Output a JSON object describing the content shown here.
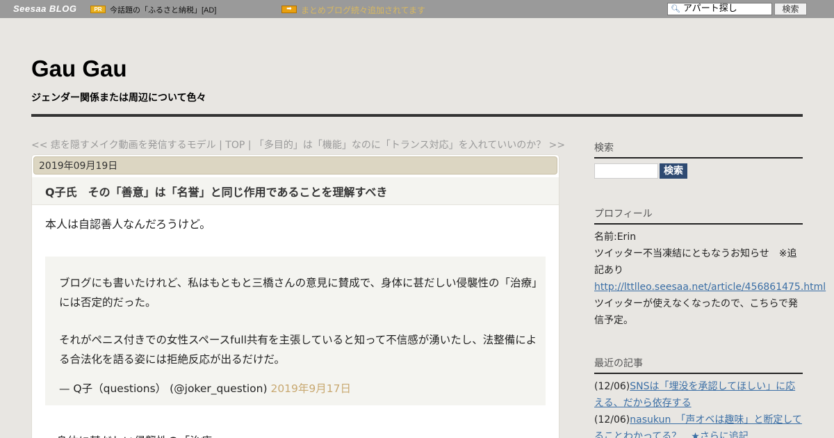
{
  "topbar": {
    "logo": "Seesaa BLOG",
    "pr_badge": "PR",
    "ad_text": "今話題の「ふるさと納税」[AD]",
    "arrow_badge": "➡",
    "notice": "まとめブログ続々追加されてます",
    "search_value": "アパート探し",
    "search_button": "検索"
  },
  "header": {
    "title": "Gau Gau",
    "description": "ジェンダー関係または周辺について色々"
  },
  "post_nav": {
    "prev": "<< 痣を隠すメイク動画を発信するモデル",
    "sep1": " | ",
    "top": "TOP",
    "sep2": " | ",
    "next": "「多目的」は「機能」なのに「トランス対応」を入れていいのか？ >>"
  },
  "article": {
    "date": "2019年09月19日",
    "title": "Q子氏　その「善意」は「名誉」と同じ作用であることを理解すべき",
    "intro": "本人は自認善人なんだろうけど。",
    "quote_p1": "ブログにも書いたけれど、私はもともと三橋さんの意見に賛成で、身体に甚だしい侵襲性の「治療」には否定的だった。",
    "quote_p2": "それがペニス付きでの女性スペースfull共有を主張していると知って不信感が湧いたし、法整備による合法化を語る姿には拒絶反応が出るだけだ。",
    "quote_author": "— Q子（questions） (@joker_question) ",
    "quote_date": "2019年9月17日",
    "after_quote": "身体に甚だしい侵襲性の「治療"
  },
  "sidebar": {
    "search_heading": "検索",
    "search_button": "検索",
    "profile_heading": "プロフィール",
    "profile_name": "名前:Erin",
    "profile_notice": "ツイッター不当凍結にともなうお知らせ　※追記あり",
    "profile_link": "http://lttlleo.seesaa.net/article/456861475.html",
    "profile_note": "ツイッターが使えなくなったので、こちらで発信予定。",
    "recent_heading": "最近の記事",
    "recent": [
      {
        "date": "(12/06)",
        "title": "SNSは「埋没を承認してほしい」に応える、だから依存する"
      },
      {
        "date": "(12/06)",
        "title": "nasukun　「声オベは趣味」と断定してることわかってる？　★さらに追記"
      }
    ]
  }
}
